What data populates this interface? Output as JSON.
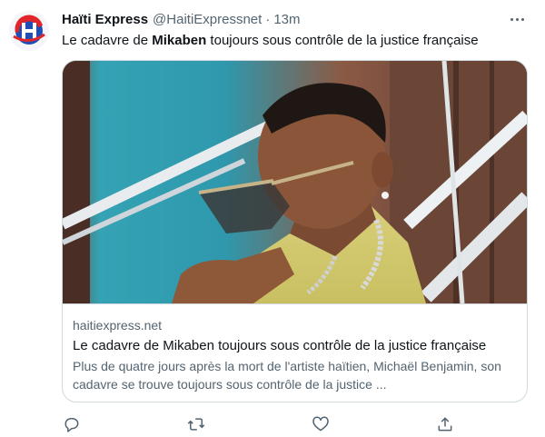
{
  "tweet": {
    "display_name": "Haïti Express",
    "handle": "@HaitiExpressnet",
    "separator": "·",
    "time": "13m",
    "text_before": "Le cadavre de ",
    "text_bold": "Mikaben",
    "text_after": " toujours sous contrôle de la justice française"
  },
  "card": {
    "domain": "haitiexpress.net",
    "title": "Le cadavre de Mikaben toujours sous contrôle de la justice française",
    "description": "Plus de quatre jours après la mort de l'artiste haïtien, Michaël Benjamin, son cadavre se trouve toujours sous contrôle de la justice ..."
  },
  "icons": {
    "avatar": "haiti-express-logo-icon",
    "more": "more-options-icon",
    "reply": "reply-icon",
    "retweet": "retweet-icon",
    "like": "like-icon",
    "share": "share-icon"
  },
  "colors": {
    "text_primary": "#0f1419",
    "text_secondary": "#536471",
    "border": "#cfd9de",
    "logo_red": "#e0252b",
    "logo_blue": "#1f4fb5"
  }
}
